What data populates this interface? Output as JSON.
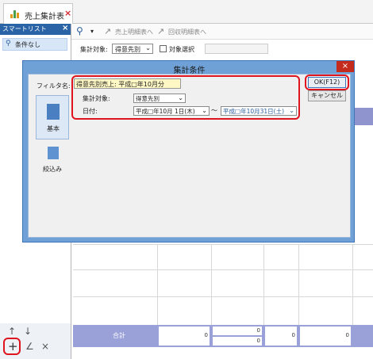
{
  "tab": {
    "title": "売上集計表",
    "close": "×"
  },
  "sidebar": {
    "title": "スマートリスト",
    "close": "×",
    "item": "条件なし",
    "bottom_up": "↑",
    "bottom_down": "↓",
    "add": "+",
    "edit": "∠",
    "delete": "×"
  },
  "toolbar": {
    "search": "⚲",
    "dropdown": "▾",
    "sales_detail": "売上明細表へ",
    "collection_detail": "回収明細表へ"
  },
  "filterbar": {
    "target_label": "集計対象:",
    "target_value": "得意先別",
    "select_label": "対象選択"
  },
  "grid": {
    "total_label": "合計",
    "totals": [
      "0",
      "0",
      "0",
      "0",
      "0"
    ]
  },
  "dialog": {
    "title": "集計条件",
    "close": "×",
    "filter_label": "フィルタ名:",
    "filter_value": "得意先別売上: 平成□年10月分",
    "side_tabs": [
      {
        "label": "基本"
      },
      {
        "label": "絞込み"
      }
    ],
    "target_label": "集計対象:",
    "target_value": "得意先別",
    "date_label": "日付:",
    "date_from": "平成□年10月 1日(木)",
    "date_sep": "～",
    "date_to": "平成□年10月31日(土)",
    "ok": "OK(F12)",
    "cancel": "キャンセル"
  },
  "colors": {
    "accent": "#2a64a6",
    "highlight": "#e0141e"
  }
}
